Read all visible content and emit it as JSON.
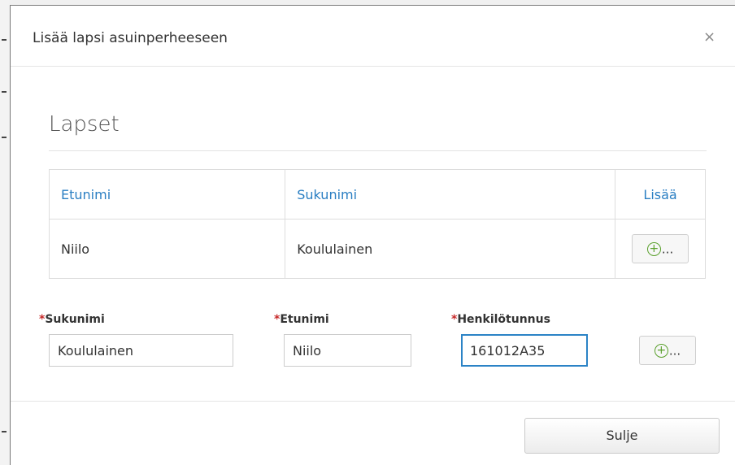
{
  "dialog": {
    "title": "Lisää lapsi asuinperheeseen",
    "close_symbol": "×"
  },
  "section": {
    "title": "Lapset"
  },
  "table": {
    "headers": [
      "Etunimi",
      "Sukunimi",
      "Lisää"
    ],
    "rows": [
      {
        "first_name": "Niilo",
        "last_name": "Koululainen",
        "add_label": "..."
      }
    ]
  },
  "form": {
    "required_mark": "*",
    "surname_label": "Sukunimi",
    "surname_value": "Koululainen",
    "firstname_label": "Etunimi",
    "firstname_value": "Niilo",
    "ssn_label": "Henkilötunnus",
    "ssn_value": "161012A35",
    "add_label": "..."
  },
  "footer": {
    "close_label": "Sulje"
  },
  "icons": {
    "plus": "plus-circle-icon",
    "close": "close-icon"
  },
  "colors": {
    "header_link": "#2b7fc3",
    "required": "#c62828",
    "plus_icon": "#5aa02c",
    "focus_border": "#2b83c6"
  }
}
